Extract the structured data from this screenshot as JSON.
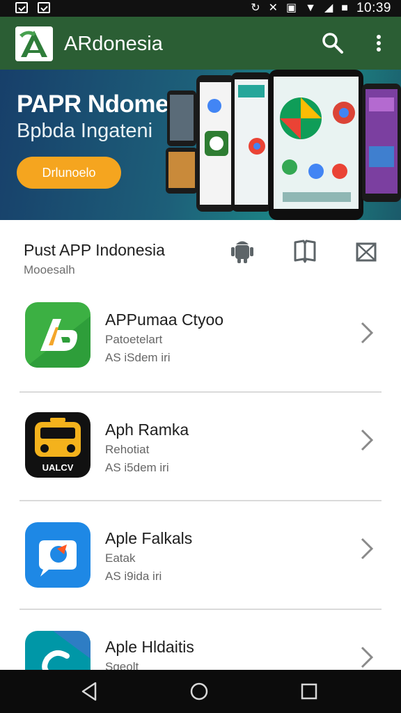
{
  "status_bar": {
    "time": "10:39"
  },
  "app_bar": {
    "title": "ARdonesia"
  },
  "banner": {
    "title": "PAPR Ndomeni",
    "subtitle": "Bpbda Ingateni",
    "cta_label": "Drlunoelo"
  },
  "section": {
    "title": "Pust APP Indonesia",
    "subtitle": "Mooesalh"
  },
  "apps": [
    {
      "name": "APPumaa Ctyoo",
      "category": "Patoetelart",
      "size": "AS iSdem iri",
      "icon": "ap-logo-icon",
      "colors": [
        "#3cb043",
        "#2e9e3a"
      ]
    },
    {
      "name": "Aph Ramka",
      "category": "Rehotiat",
      "size": "AS i5dem iri",
      "icon": "bus-icon",
      "colors": [
        "#111111",
        "#f4b21c"
      ]
    },
    {
      "name": "Aple Falkals",
      "category": "Eatak",
      "size": "AS i9ida iri",
      "icon": "camera-bubble-icon",
      "colors": [
        "#1e88e5",
        "#ff5722"
      ]
    },
    {
      "name": "Aple Hldaitis",
      "category": "Sgeolt",
      "size": "",
      "icon": "teal-c-icon",
      "colors": [
        "#0097a7",
        "#2e7dc4"
      ]
    }
  ],
  "colors": {
    "app_bar": "#2b5e34",
    "cta": "#f5a51f"
  }
}
